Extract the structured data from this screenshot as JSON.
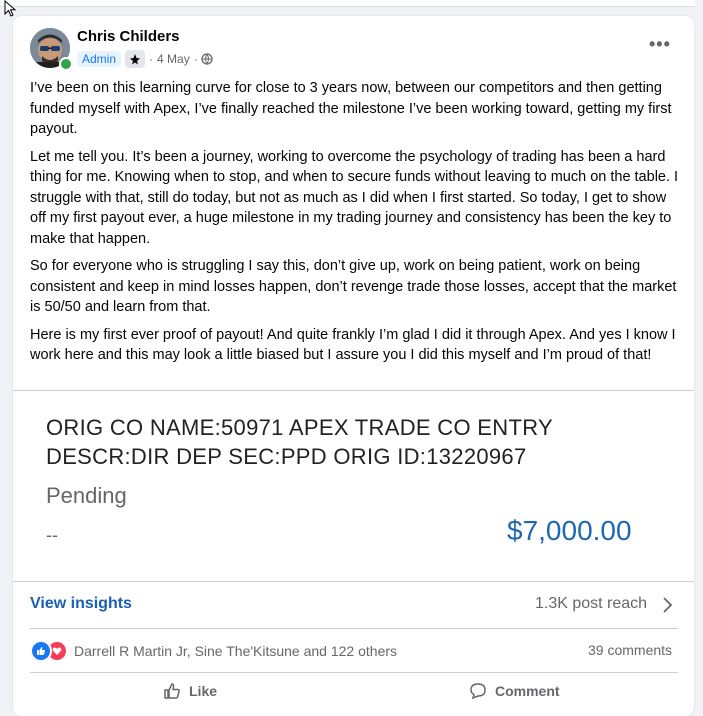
{
  "post": {
    "author": "Chris Childers",
    "role_badge": "Admin",
    "date": "4 May",
    "separator": "·",
    "more_label": "•••",
    "paragraphs": [
      "I’ve been on this learning curve for close to 3 years now, between our competitors and then getting funded myself with Apex, I’ve finally reached the milestone I’ve been working toward, getting my first payout.",
      "Let me tell you. It’s been a journey, working to overcome the psychology of trading has been a hard thing for me. Knowing when to stop, and when to secure funds without leaving to much on the table. I struggle with that, still do today, but not as much as I did when I first started. So today, I get to show off my first payout ever, a huge milestone in my trading journey and consistency has been the key to make that happen.",
      "So for everyone who is struggling I say this, don’t give up, work on being patient, work on being consistent and keep in mind losses happen, don’t revenge trade those losses, accept that the market is 50/50 and learn from that.",
      "Here is my first ever proof of payout! And quite frankly I’m glad I did it through Apex. And yes I know I work here and this may look a little biased but I assure you I did this myself and I’m proud of that!"
    ]
  },
  "embed": {
    "title": "ORIG CO NAME:50971 APEX TRADE CO ENTRY DESCR:DIR DEP SEC:PPD ORIG ID:13220967",
    "status": "Pending",
    "dash": "--",
    "amount": "$7,000.00",
    "amount_color": "#1e67b3"
  },
  "insights": {
    "link_label": "View insights",
    "reach": "1.3K post reach"
  },
  "engagement": {
    "reactors": "Darrell R Martin Jr, Sine The'Kitsune and 122 others",
    "comments": "39 comments"
  },
  "actions": {
    "like": "Like",
    "comment": "Comment"
  },
  "colors": {
    "like_blue": "#1877f2",
    "love_red": "#f33e58",
    "online_green": "#31a24c"
  }
}
